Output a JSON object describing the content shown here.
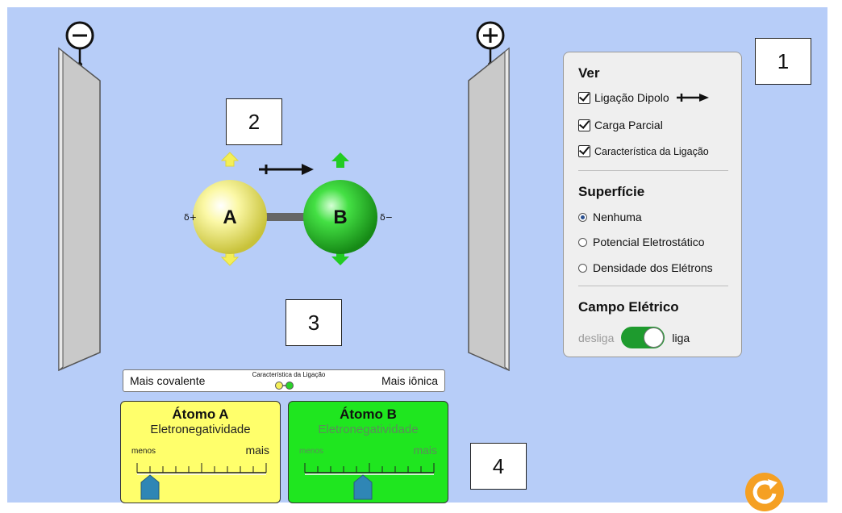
{
  "plates": {
    "left_symbol": "minus-symbol",
    "right_symbol": "plus-symbol"
  },
  "molecule": {
    "atom_a": {
      "label": "A",
      "partial_charge": "δ+",
      "color": "#f2f07a"
    },
    "atom_b": {
      "label": "B",
      "partial_charge": "δ−",
      "color": "#3ad13a"
    }
  },
  "callouts": {
    "c1": "1",
    "c2": "2",
    "c3": "3",
    "c4": "4"
  },
  "panel": {
    "view_title": "Ver",
    "checkboxes": [
      {
        "label": "Ligação Dipolo",
        "checked": true
      },
      {
        "label": "Carga Parcial",
        "checked": true
      },
      {
        "label": "Característica da Ligação",
        "checked": true
      }
    ],
    "surface_title": "Superfície",
    "radios": [
      {
        "label": "Nenhuma",
        "selected": true
      },
      {
        "label": "Potencial Eletrostático",
        "selected": false
      },
      {
        "label": "Densidade dos Elétrons",
        "selected": false
      }
    ],
    "field_title": "Campo Elétrico",
    "toggle_off": "desliga",
    "toggle_on": "liga",
    "toggle_state": "liga"
  },
  "bond_bar": {
    "left": "Mais covalente",
    "center": "Característica da Ligação",
    "right": "Mais iônica"
  },
  "meter_a": {
    "title": "Átomo A",
    "subtitle": "Eletronegatividade",
    "low": "menos",
    "high": "mais",
    "value_fraction": 0.1,
    "color": "#ffff6b"
  },
  "meter_b": {
    "title": "Átomo B",
    "subtitle": "Eletronegatividade",
    "low": "menos",
    "high": "mais",
    "value_fraction": 0.45,
    "color": "#1fe61f"
  },
  "reset_icon": "reset-icon",
  "colors": {
    "background": "#b7cdf8",
    "plate": "#c8c8c8",
    "toggle": "#1e9b2e",
    "reset": "#f5a023"
  }
}
